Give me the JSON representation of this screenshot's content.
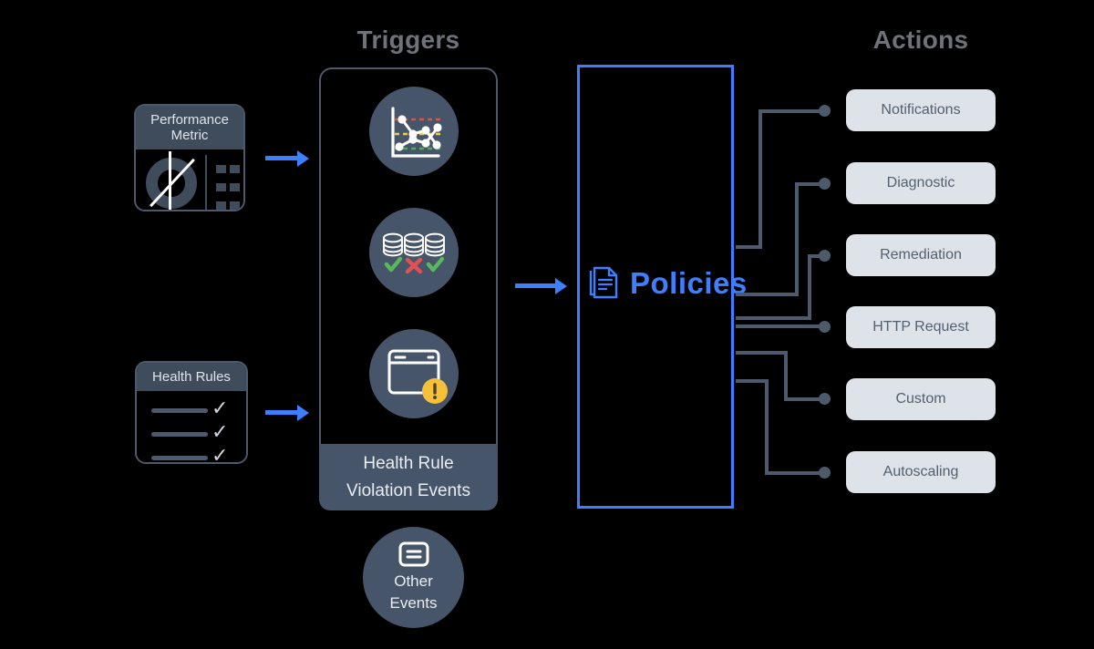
{
  "columns": {
    "triggers_heading": "Triggers",
    "actions_heading": "Actions"
  },
  "sources": [
    {
      "id": "performance-metric",
      "title_line1": "Performance",
      "title_line2": "Metric",
      "icon": "donut-chart-icon"
    },
    {
      "id": "health-rules",
      "title_line1": "Health Rules",
      "title_line2": "",
      "icon": "checklist-icon"
    }
  ],
  "triggers": {
    "items": [
      {
        "icon": "line-chart-threshold-icon",
        "label": ""
      },
      {
        "icon": "database-status-icon",
        "label": ""
      },
      {
        "icon": "browser-window-alert-icon",
        "label": ""
      }
    ],
    "group_label_line1": "Health Rule",
    "group_label_line2": "Violation Events",
    "other": {
      "icon": "list-panel-icon",
      "label_line1": "Other",
      "label_line2": "Events"
    }
  },
  "policies": {
    "label": "Policies",
    "icon": "documents-icon"
  },
  "actions": [
    {
      "label": "Notifications"
    },
    {
      "label": "Diagnostic"
    },
    {
      "label": "Remediation"
    },
    {
      "label": "HTTP Request"
    },
    {
      "label": "Custom"
    },
    {
      "label": "Autoscaling"
    }
  ],
  "colors": {
    "background": "#000000",
    "accent_blue": "#3d7fff",
    "slate": "#47556a",
    "slate_border": "#4d5a6b",
    "heading_gray": "#6f7278",
    "pill_bg": "#dde3e8",
    "pill_text": "#55606e",
    "threshold_red": "#d9534f",
    "threshold_yellow": "#e8d24a",
    "threshold_green": "#4caf50",
    "alert_yellow": "#f5c13b",
    "check_green": "#5cb85c",
    "cross_red": "#e05252"
  }
}
